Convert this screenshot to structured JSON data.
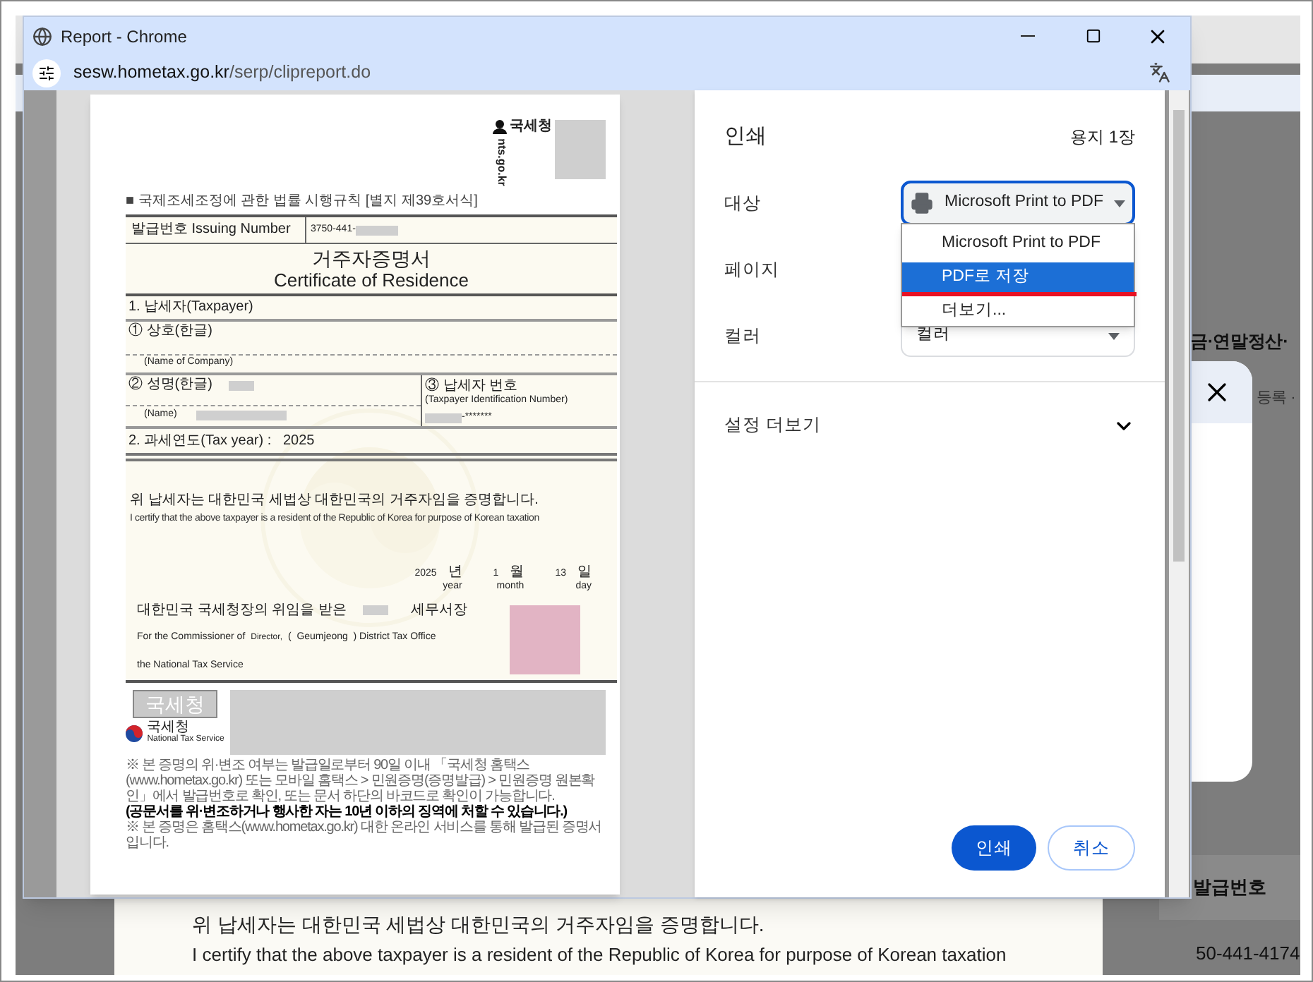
{
  "background_page": {
    "heading_fragment": "금·연말정산·",
    "dialog_text_fragment": "등록 ·",
    "table_header": "발급번호",
    "table_cell": "50-441-4174",
    "statement_ko": "위 납세자는 대한민국 세법상 대한민국의 거주자임을 증명합니다.",
    "statement_en": "I certify that the above taxpayer is a resident of the Republic of Korea for purpose of Korean taxation"
  },
  "window": {
    "title": "Report - Chrome",
    "url_host": "sesw.hometax.go.kr",
    "url_path": "/serp/clipreport.do"
  },
  "document": {
    "agency_label": "국세청",
    "domain": "nts.go.kr",
    "form_reference": "■ 국제조세조정에 관한 법률 시행규칙 [별지 제39호서식]",
    "issuing_label": "발급번호 Issuing Number",
    "issuing_number": "3750-441-",
    "title_ko": "거주자증명서",
    "title_en": "Certificate of Residence",
    "section_taxpayer": "1. 납세자(Taxpayer)",
    "company_label": "① 상호(한글)",
    "company_en": "(Name of Company)",
    "name_label": "② 성명(한글)",
    "name_en": "(Name)",
    "tin_label": "③ 납세자 번호",
    "tin_en": "(Taxpayer Identification Number)",
    "tin_value": "-*******",
    "tax_year": "2. 과세연도(Tax year) :   2025",
    "statement_ko": "위 납세자는 대한민국 세법상 대한민국의 거주자임을 증명합니다.",
    "statement_en": "I certify that the above taxpayer is a resident of the Republic of Korea for purpose of Korean taxation",
    "date": [
      {
        "number": "2025",
        "unit_ko": "년",
        "unit_en": "year"
      },
      {
        "number": "1",
        "unit_ko": "월",
        "unit_en": "month"
      },
      {
        "number": "13",
        "unit_ko": "일",
        "unit_en": "day"
      }
    ],
    "delegation_ko": "대한민국 국세청장의 위임을 받은",
    "office_ko": "세무서장",
    "commissioner_en": "For the Commissioner of",
    "director": "Director,",
    "office_open": "(",
    "office_name": "Geumjeong",
    "office_en": ") District Tax Office",
    "nts_en": "the National Tax Service",
    "seal_text": "국세청",
    "logo_text": "국세청",
    "logo_sub": "National Tax Service",
    "notes": [
      {
        "text": "※ 본 증명의 위·변조 여부는 발급일로부터 90일 이내 「국세청 홈택스(www.hometax.go.kr) 또는 모바일 홈택스 > 민원증명(증명발급) > 민원증명 원본확인」에서 발급번호로 확인, 또는 문서 하단의 바코드로 확인이 가능합니다.",
        "emphasis": false
      },
      {
        "text": "(공문서를 위·변조하거나 행사한 자는 10년 이하의 징역에 처할 수 있습니다.)",
        "emphasis": true
      },
      {
        "text": "※ 본 증명은 홈택스(www.hometax.go.kr) 대한 온라인 서비스를 통해 발급된 증명서입니다.",
        "emphasis": false
      }
    ]
  },
  "print_panel": {
    "title": "인쇄",
    "sheet_count": "용지 1장",
    "rows": [
      {
        "label": "대상",
        "kind": "destination",
        "value": "Microsoft Print to PDF",
        "open": true,
        "options": [
          {
            "label": "Microsoft Print to PDF",
            "highlighted": false
          },
          {
            "label": "PDF로 저장",
            "highlighted": true
          },
          {
            "label": "더보기...",
            "highlighted": false
          }
        ]
      },
      {
        "label": "페이지",
        "kind": "pages"
      },
      {
        "label": "컬러",
        "kind": "select",
        "value": "컬러"
      }
    ],
    "more_settings": "설정 더보기",
    "expanded": false,
    "print_button": "인쇄",
    "cancel_button": "취소"
  }
}
